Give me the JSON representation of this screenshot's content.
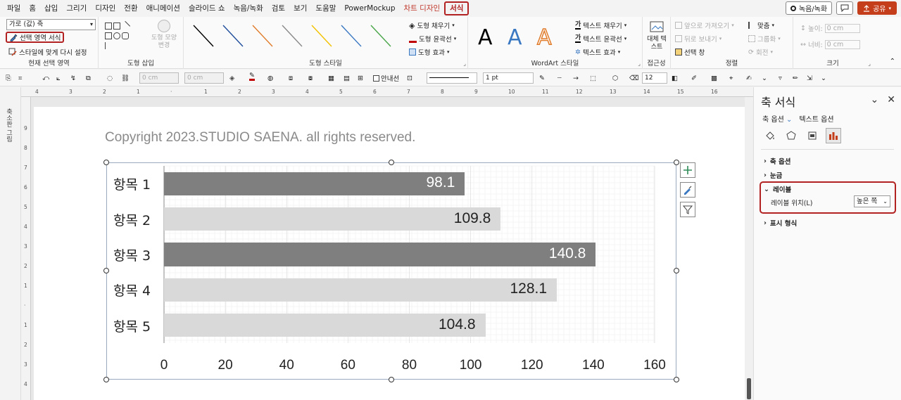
{
  "menubar": {
    "items": [
      "파일",
      "홈",
      "삽입",
      "그리기",
      "디자인",
      "전환",
      "애니메이션",
      "슬라이드 쇼",
      "녹음/녹화",
      "검토",
      "보기",
      "도움말",
      "PowerMockup"
    ],
    "context_tab": "차트 디자인",
    "active_tab": "서식",
    "record_label": "녹음/녹화",
    "share_label": "공유"
  },
  "ribbon": {
    "current_selection": {
      "dropdown_value": "가로 (값) 축",
      "format_selection": "선택 영역 서식",
      "reset_style": "스타일에 맞게 다시 설정",
      "label": "현재 선택 영역"
    },
    "insert_shapes": {
      "change_shape": "도형 모양 변경",
      "label": "도형 삽입"
    },
    "shape_styles": {
      "fill": "도형 채우기",
      "outline": "도형 윤곽선",
      "effects": "도형 효과",
      "label": "도형 스타일",
      "line_colors": [
        "#000000",
        "#1f4e9c",
        "#e07b2a",
        "#8a8a8a",
        "#f2c200",
        "#3a78c2",
        "#4aa64a"
      ]
    },
    "wordart": {
      "letters": [
        "A",
        "A",
        "A"
      ],
      "text_fill": "텍스트 채우기",
      "text_outline": "텍스트 윤곽선",
      "text_effects": "텍스트 효과",
      "label": "WordArt 스타일"
    },
    "accessibility": {
      "alt_text": "대체 텍스트",
      "label": "접근성"
    },
    "arrange": {
      "bring_forward": "앞으로 가져오기",
      "send_backward": "뒤로 보내기",
      "selection_pane": "선택 창",
      "align": "맞춤",
      "group": "그룹화",
      "rotate": "회전",
      "label": "정렬"
    },
    "size": {
      "height_label": "높이:",
      "height_value": "0 cm",
      "width_label": "너비:",
      "width_value": "0 cm",
      "label": "크기"
    }
  },
  "quickbar": {
    "size_a": "0 cm",
    "size_b": "0 cm",
    "guide_label": "안내선",
    "line_weight": "1 pt",
    "font_size": "12"
  },
  "left_panel": {
    "label": "축소판 그림"
  },
  "rulers": {
    "top": [
      "4",
      "3",
      "2",
      "1",
      "",
      "1",
      "2",
      "3",
      "4",
      "5",
      "6",
      "7",
      "8",
      "9",
      "10",
      "11",
      "12",
      "13",
      "14",
      "15",
      "16"
    ],
    "left": [
      "9",
      "8",
      "7",
      "6",
      "5",
      "4",
      "3",
      "2",
      "1",
      "",
      "1",
      "2",
      "3",
      "4",
      "5"
    ]
  },
  "slide": {
    "copyright": "Copyright 2023.STUDIO SAENA. all rights reserved."
  },
  "chart_data": {
    "type": "bar",
    "orientation": "horizontal",
    "categories": [
      "항목 1",
      "항목 2",
      "항목 3",
      "항목 4",
      "항목 5"
    ],
    "values": [
      98.1,
      109.8,
      140.8,
      128.1,
      104.8
    ],
    "data_labels": [
      "98.1",
      "109.8",
      "140.8",
      "128.1",
      "104.8"
    ],
    "bar_colors": [
      "#7f7f7f",
      "#d9d9d9",
      "#7f7f7f",
      "#d9d9d9",
      "#d9d9d9"
    ],
    "label_colors": [
      "#ffffff",
      "#222222",
      "#ffffff",
      "#222222",
      "#222222"
    ],
    "x_ticks": [
      "0",
      "20",
      "40",
      "60",
      "80",
      "100",
      "120",
      "140",
      "160"
    ],
    "xlim": [
      0,
      160
    ],
    "grid": true,
    "legend": "none"
  },
  "pane": {
    "title": "축 서식",
    "tab_axis": "축 옵션",
    "tab_text": "텍스트 옵션",
    "sections": {
      "axis_options": "축 옵션",
      "ticks": "눈금",
      "labels": "레이블",
      "number": "표시 형식"
    },
    "label_position_label": "레이블 위치(L)",
    "label_position_value": "높은 쪽"
  }
}
